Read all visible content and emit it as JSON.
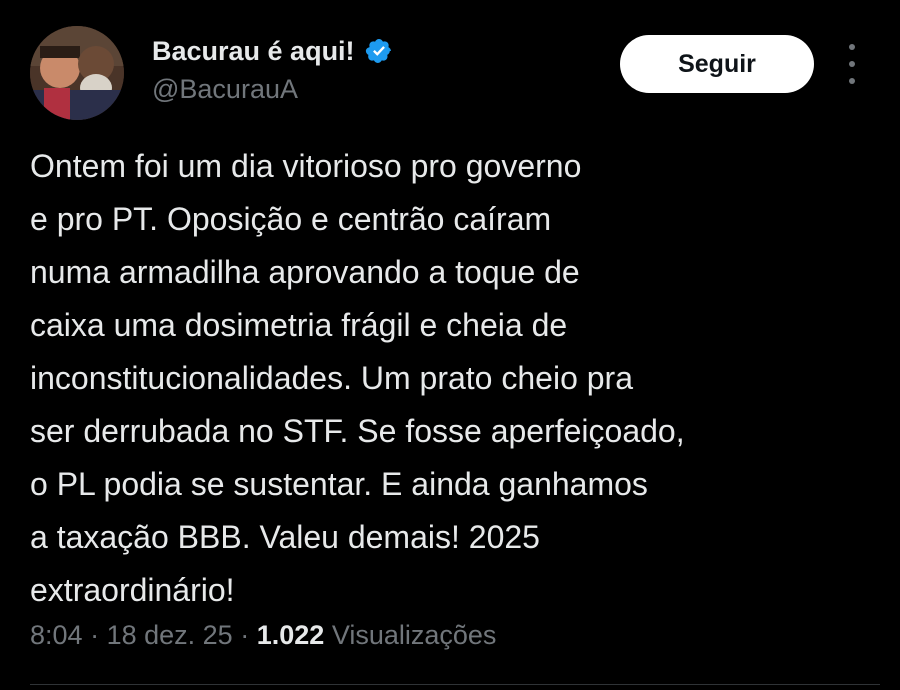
{
  "author": {
    "display_name": "Bacurau é aqui!",
    "handle": "@BacurauA",
    "verified": true,
    "avatar_icon": "profile-photo"
  },
  "actions": {
    "follow_label": "Seguir",
    "more_icon": "more-vertical-icon"
  },
  "tweet": {
    "text": "Ontem foi um dia vitorioso pro governo\ne pro PT. Oposição e centrão caíram\nnuma armadilha aprovando a toque de\ncaixa uma dosimetria frágil e cheia de\ninconstitucionalidades. Um prato cheio pra\nser derrubada no STF. Se fosse aperfeiçoado,\no PL podia se sustentar. E ainda ganhamos\na taxação BBB. Valeu demais! 2025\nextraordinário!"
  },
  "meta": {
    "time": "8:04",
    "separator": "·",
    "date": "18 dez. 25",
    "views_count": "1.022",
    "views_label": "Visualizações"
  },
  "colors": {
    "background": "#000000",
    "primary_text": "#e7e9ea",
    "secondary_text": "#71767b",
    "verified_badge": "#1d9bf0",
    "button_bg": "#ffffff",
    "button_text": "#0f1419"
  }
}
